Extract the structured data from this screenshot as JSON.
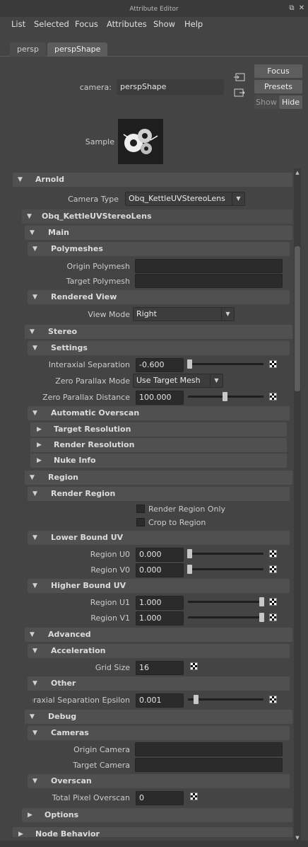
{
  "window": {
    "title": "Attribute Editor",
    "float_icon": "float-window-icon",
    "close_icon": "close-icon"
  },
  "menu": [
    "List",
    "Selected",
    "Focus",
    "Attributes",
    "Show",
    "Help"
  ],
  "tabs": [
    {
      "label": "persp",
      "active": false
    },
    {
      "label": "perspShape",
      "active": true
    }
  ],
  "header": {
    "camera_label": "camera:",
    "camera_value": "perspShape",
    "focus_label": "Focus",
    "presets_label": "Presets",
    "show_label": "Show",
    "hide_label": "Hide",
    "sample_label": "Sample"
  },
  "arnold": {
    "title": "Arnold",
    "camera_type_label": "Camera Type",
    "camera_type_value": "Obq_KettleUVStereoLens",
    "lens_title": "Obq_KettleUVStereoLens",
    "main_title": "Main",
    "polymeshes_title": "Polymeshes",
    "origin_polymesh_label": "Origin Polymesh",
    "origin_polymesh_value": "",
    "target_polymesh_label": "Target Polymesh",
    "target_polymesh_value": "",
    "rendered_view_title": "Rendered View",
    "view_mode_label": "View Mode",
    "view_mode_value": "Right",
    "stereo_title": "Stereo",
    "settings_title": "Settings",
    "interaxial_label": "Interaxial Separation",
    "interaxial_value": "-0.600",
    "interaxial_slider": 0.0,
    "zero_parallax_mode_label": "Zero Parallax Mode",
    "zero_parallax_mode_value": "Use Target Mesh",
    "zero_parallax_distance_label": "Zero Parallax Distance",
    "zero_parallax_distance_value": "100.000",
    "zero_parallax_distance_slider": 0.48,
    "automatic_overscan_title": "Automatic Overscan",
    "target_resolution_title": "Target Resolution",
    "render_resolution_title": "Render Resolution",
    "nuke_info_title": "Nuke Info",
    "region_title": "Region",
    "render_region_title": "Render Region",
    "render_region_only_label": "Render Region Only",
    "crop_to_region_label": "Crop to Region",
    "lower_bound_title": "Lower Bound UV",
    "region_u0_label": "Region U0",
    "region_u0_value": "0.000",
    "region_v0_label": "Region V0",
    "region_v0_value": "0.000",
    "higher_bound_title": "Higher Bound UV",
    "region_u1_label": "Region U1",
    "region_u1_value": "1.000",
    "region_v1_label": "Region V1",
    "region_v1_value": "1.000",
    "advanced_title": "Advanced",
    "acceleration_title": "Acceleration",
    "grid_size_label": "Grid Size",
    "grid_size_value": "16",
    "other_title": "Other",
    "epsilon_label": "Interaxial Separation Epsilon",
    "epsilon_value": "0.001",
    "debug_title": "Debug",
    "cameras_title": "Cameras",
    "origin_camera_label": "Origin Camera",
    "origin_camera_value": "",
    "target_camera_label": "Target Camera",
    "target_camera_value": "",
    "overscan_title": "Overscan",
    "total_pixel_overscan_label": "Total Pixel Overscan",
    "total_pixel_overscan_value": "0",
    "options_title": "Options",
    "node_behavior_title": "Node Behavior"
  }
}
